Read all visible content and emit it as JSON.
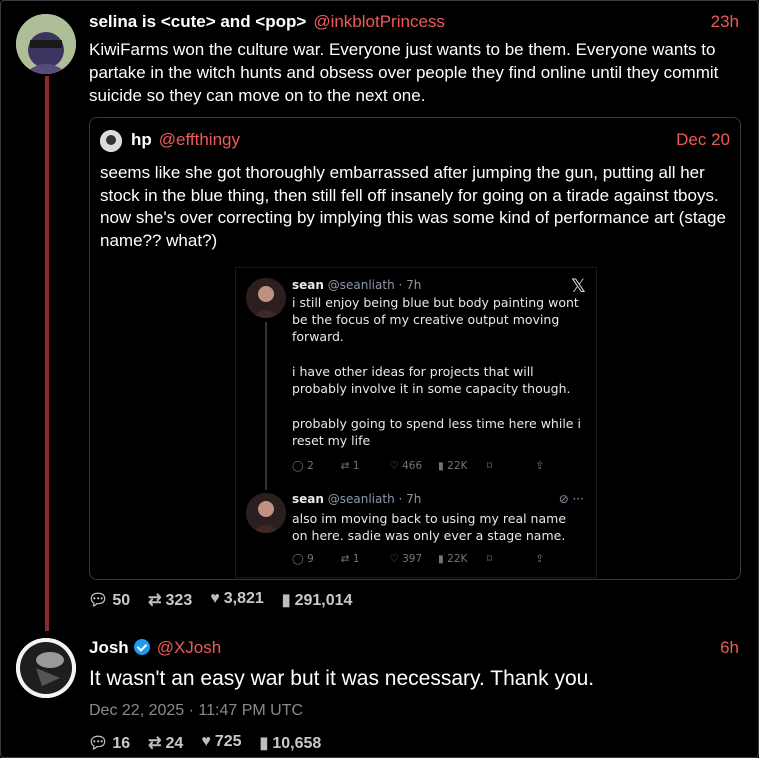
{
  "post1": {
    "name": "selina is <cute> and <pop>",
    "handle": "@inkblotPrincess",
    "time": "23h",
    "text": "KiwiFarms won the culture war. Everyone just wants to be them. Everyone wants to partake in the witch hunts and obsess over people they find online until they commit suicide so they can move on to the next one.",
    "stats": {
      "replies": "50",
      "reposts": "323",
      "likes": "3,821",
      "views": "291,014"
    }
  },
  "quote": {
    "name": "hp",
    "handle": "@effthingy",
    "time": "Dec 20",
    "text": "seems like she got thoroughly embarrassed after jumping the gun, putting all her stock in the blue thing, then still fell off insanely for going on a tirade against tboys. now she's over correcting by implying this was some kind of performance art (stage name?? what?)"
  },
  "screenshot": {
    "tweet1": {
      "name": "sean",
      "handle": "@seanliath · 7h",
      "p1": "i still enjoy being blue but body painting wont be the focus of my creative output moving forward.",
      "p2": "i have other ideas for projects that will probably involve it in some capacity though.",
      "p3": "probably going to spend less time here while i reset my life",
      "replies": "2",
      "reposts": "1",
      "likes": "466",
      "views": "22K"
    },
    "tweet2": {
      "name": "sean",
      "handle": "@seanliath · 7h",
      "text": "also im moving back to using my real name on here. sadie was only ever a stage name.",
      "replies": "9",
      "reposts": "1",
      "likes": "397",
      "views": "22K"
    }
  },
  "post2": {
    "name": "Josh",
    "handle": "@XJosh",
    "time": "6h",
    "text": "It wasn't an easy war but it was necessary. Thank you.",
    "date": "Dec 22, 2025 · 11:47 PM UTC",
    "stats": {
      "replies": "16",
      "reposts": "24",
      "likes": "725",
      "views": "10,658"
    }
  },
  "icons": [
    "reply-icon",
    "repost-icon",
    "like-icon",
    "views-icon",
    "verified-icon",
    "x-logo-icon"
  ]
}
